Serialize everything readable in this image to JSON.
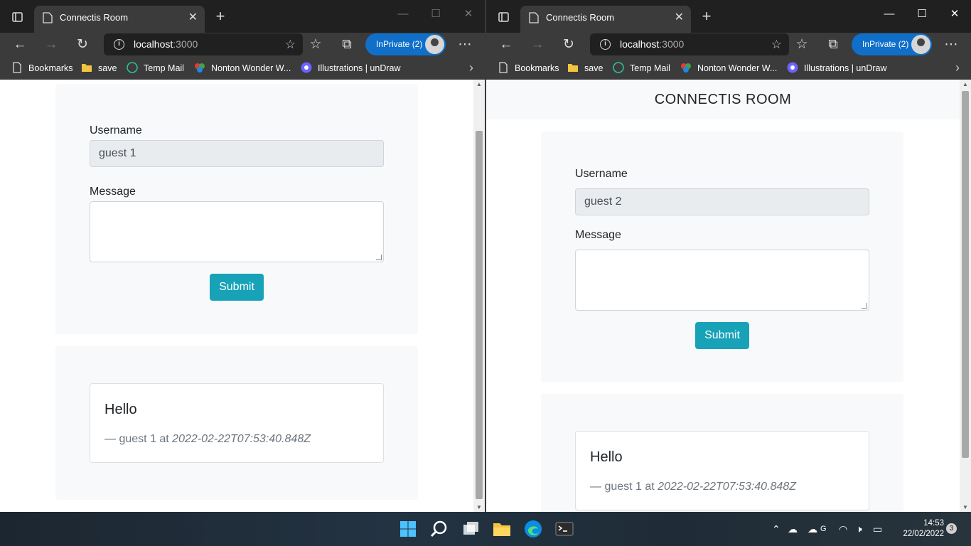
{
  "windows": [
    {
      "tab_title": "Connectis Room",
      "url_host": "localhost",
      "url_port": ":3000",
      "inprivate_label": "InPrivate (2)",
      "bookmarks": [
        "Bookmarks",
        "save",
        "Temp Mail",
        "Nonton Wonder W...",
        "Illustrations | unDraw"
      ],
      "page_header": "",
      "form": {
        "username_label": "Username",
        "username_value": "guest 1",
        "message_label": "Message",
        "submit_label": "Submit"
      },
      "message": {
        "text": "Hello",
        "author_prefix": "— guest 1 at ",
        "timestamp": "2022-02-22T07:53:40.848Z"
      }
    },
    {
      "tab_title": "Connectis Room",
      "url_host": "localhost",
      "url_port": ":3000",
      "inprivate_label": "InPrivate (2)",
      "bookmarks": [
        "Bookmarks",
        "save",
        "Temp Mail",
        "Nonton Wonder W...",
        "Illustrations | unDraw"
      ],
      "page_header": "CONNECTIS ROOM",
      "form": {
        "username_label": "Username",
        "username_value": "guest 2",
        "message_label": "Message",
        "submit_label": "Submit"
      },
      "message": {
        "text": "Hello",
        "author_prefix": "— guest 1 at ",
        "timestamp": "2022-02-22T07:53:40.848Z"
      }
    }
  ],
  "taskbar": {
    "time": "14:53",
    "date": "22/02/2022",
    "notification_count": "3",
    "input_indicator": "G"
  },
  "colors": {
    "accent": "#17a2b8",
    "inprivate": "#0f6fc9"
  }
}
